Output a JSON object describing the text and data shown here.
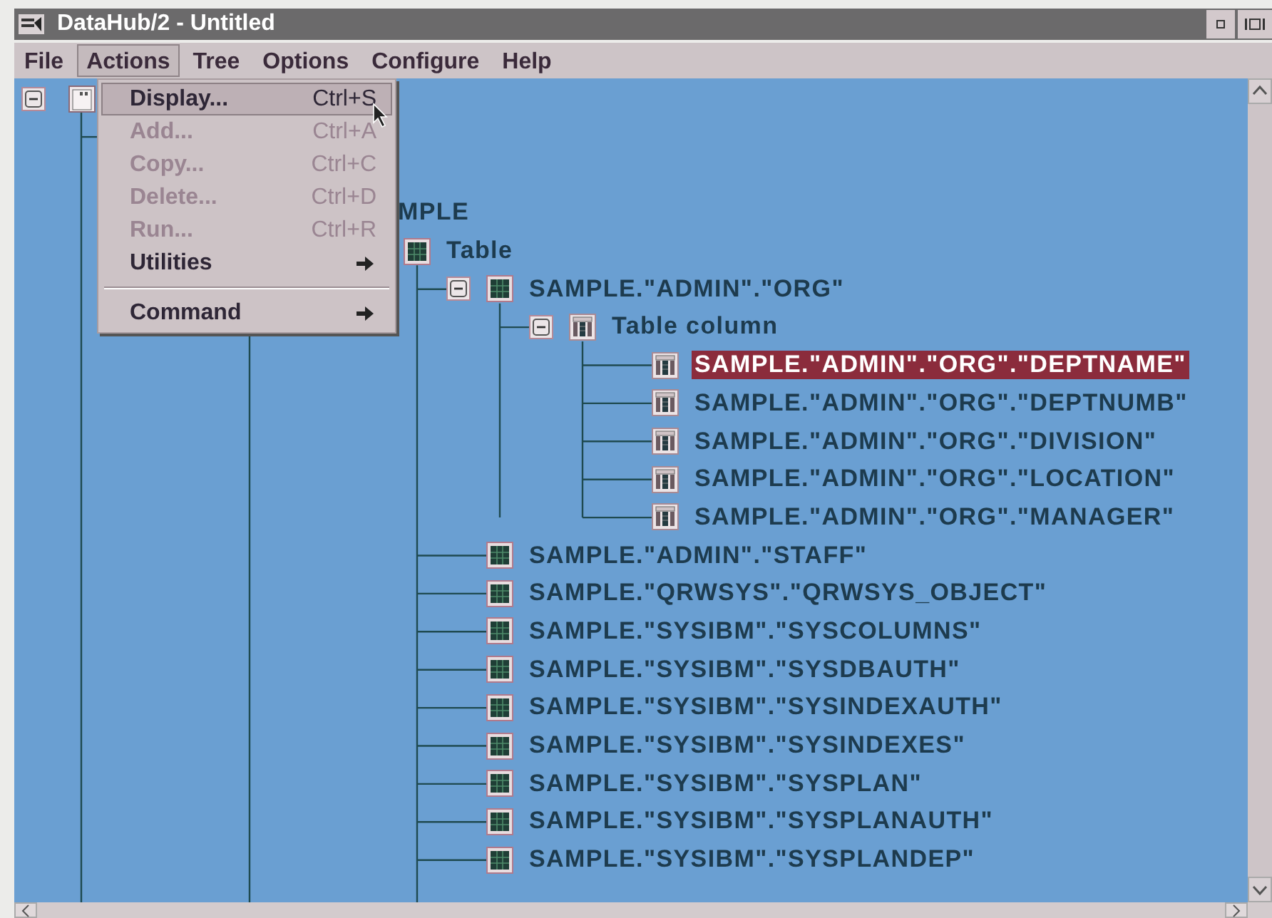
{
  "window": {
    "title": "DataHub/2 - Untitled"
  },
  "menu_bar": [
    {
      "label": "File",
      "selected": false
    },
    {
      "label": "Actions",
      "selected": true
    },
    {
      "label": "Tree",
      "selected": false
    },
    {
      "label": "Options",
      "selected": false
    },
    {
      "label": "Configure",
      "selected": false
    },
    {
      "label": "Help",
      "selected": false
    }
  ],
  "actions_menu": [
    {
      "kind": "item",
      "label": "Display...",
      "shortcut": "Ctrl+S",
      "disabled": false,
      "selected": true
    },
    {
      "kind": "item",
      "label": "Add...",
      "shortcut": "Ctrl+A",
      "disabled": true,
      "selected": false
    },
    {
      "kind": "item",
      "label": "Copy...",
      "shortcut": "Ctrl+C",
      "disabled": true,
      "selected": false
    },
    {
      "kind": "item",
      "label": "Delete...",
      "shortcut": "Ctrl+D",
      "disabled": true,
      "selected": false
    },
    {
      "kind": "item",
      "label": "Run...",
      "shortcut": "Ctrl+R",
      "disabled": true,
      "selected": false
    },
    {
      "kind": "submenu",
      "label": "Utilities",
      "disabled": false,
      "selected": false
    },
    {
      "kind": "separator"
    },
    {
      "kind": "submenu",
      "label": "Command",
      "disabled": false,
      "selected": false
    }
  ],
  "tree": {
    "root": {
      "expanded": true,
      "selected": false
    },
    "nodes": [
      {
        "kind": "cut",
        "label": "MPLE",
        "selected": false,
        "children": [
          {
            "kind": "table",
            "label": "Table",
            "selected": false,
            "children": [
              {
                "kind": "table",
                "label": "SAMPLE.\"ADMIN\".\"ORG\"",
                "expanded": true,
                "selected": false,
                "children": [
                  {
                    "kind": "column",
                    "label": "Table column",
                    "expanded": true,
                    "selected": false,
                    "children": [
                      {
                        "kind": "column",
                        "label": "SAMPLE.\"ADMIN\".\"ORG\".\"DEPTNAME\"",
                        "selected": true
                      },
                      {
                        "kind": "column",
                        "label": "SAMPLE.\"ADMIN\".\"ORG\".\"DEPTNUMB\"",
                        "selected": false
                      },
                      {
                        "kind": "column",
                        "label": "SAMPLE.\"ADMIN\".\"ORG\".\"DIVISION\"",
                        "selected": false
                      },
                      {
                        "kind": "column",
                        "label": "SAMPLE.\"ADMIN\".\"ORG\".\"LOCATION\"",
                        "selected": false
                      },
                      {
                        "kind": "column",
                        "label": "SAMPLE.\"ADMIN\".\"ORG\".\"MANAGER\"",
                        "selected": false
                      }
                    ]
                  }
                ]
              },
              {
                "kind": "table",
                "label": "SAMPLE.\"ADMIN\".\"STAFF\"",
                "selected": false
              },
              {
                "kind": "table",
                "label": "SAMPLE.\"QRWSYS\".\"QRWSYS_OBJECT\"",
                "selected": false
              },
              {
                "kind": "table",
                "label": "SAMPLE.\"SYSIBM\".\"SYSCOLUMNS\"",
                "selected": false
              },
              {
                "kind": "table",
                "label": "SAMPLE.\"SYSIBM\".\"SYSDBAUTH\"",
                "selected": false
              },
              {
                "kind": "table",
                "label": "SAMPLE.\"SYSIBM\".\"SYSINDEXAUTH\"",
                "selected": false
              },
              {
                "kind": "table",
                "label": "SAMPLE.\"SYSIBM\".\"SYSINDEXES\"",
                "selected": false
              },
              {
                "kind": "table",
                "label": "SAMPLE.\"SYSIBM\".\"SYSPLAN\"",
                "selected": false
              },
              {
                "kind": "table",
                "label": "SAMPLE.\"SYSIBM\".\"SYSPLANAUTH\"",
                "selected": false
              },
              {
                "kind": "table",
                "label": "SAMPLE.\"SYSIBM\".\"SYSPLANDEP\"",
                "selected": false
              }
            ]
          }
        ]
      }
    ]
  }
}
